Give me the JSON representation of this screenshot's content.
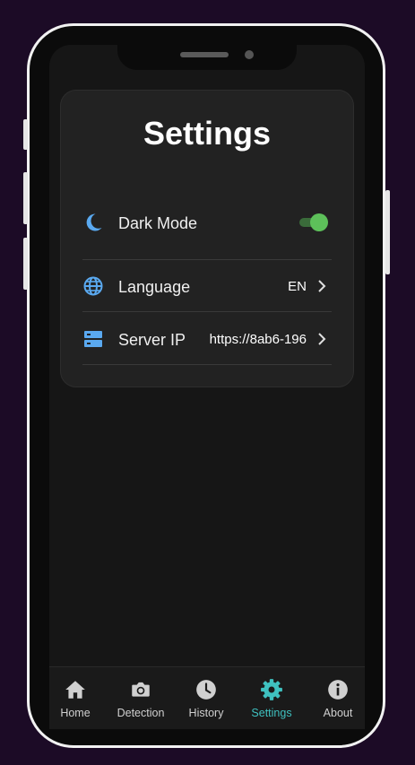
{
  "settings": {
    "title": "Settings",
    "rows": [
      {
        "icon": "moon-icon",
        "label": "Dark Mode",
        "toggle_on": true
      },
      {
        "icon": "globe-icon",
        "label": "Language",
        "value": "EN"
      },
      {
        "icon": "server-icon",
        "label": "Server IP",
        "value": "https://8ab6-196"
      }
    ]
  },
  "tabs": [
    {
      "icon": "home-icon",
      "label": "Home",
      "active": false
    },
    {
      "icon": "camera-icon",
      "label": "Detection",
      "active": false
    },
    {
      "icon": "clock-icon",
      "label": "History",
      "active": false
    },
    {
      "icon": "gear-icon",
      "label": "Settings",
      "active": true
    },
    {
      "icon": "info-icon",
      "label": "About",
      "active": false
    }
  ],
  "colors": {
    "accent": "#3fc1c0",
    "icon_blue": "#5aa9f0",
    "toggle_on": "#5dc05a",
    "background": "#1c0b26",
    "screen": "#161616",
    "card": "#222222"
  }
}
